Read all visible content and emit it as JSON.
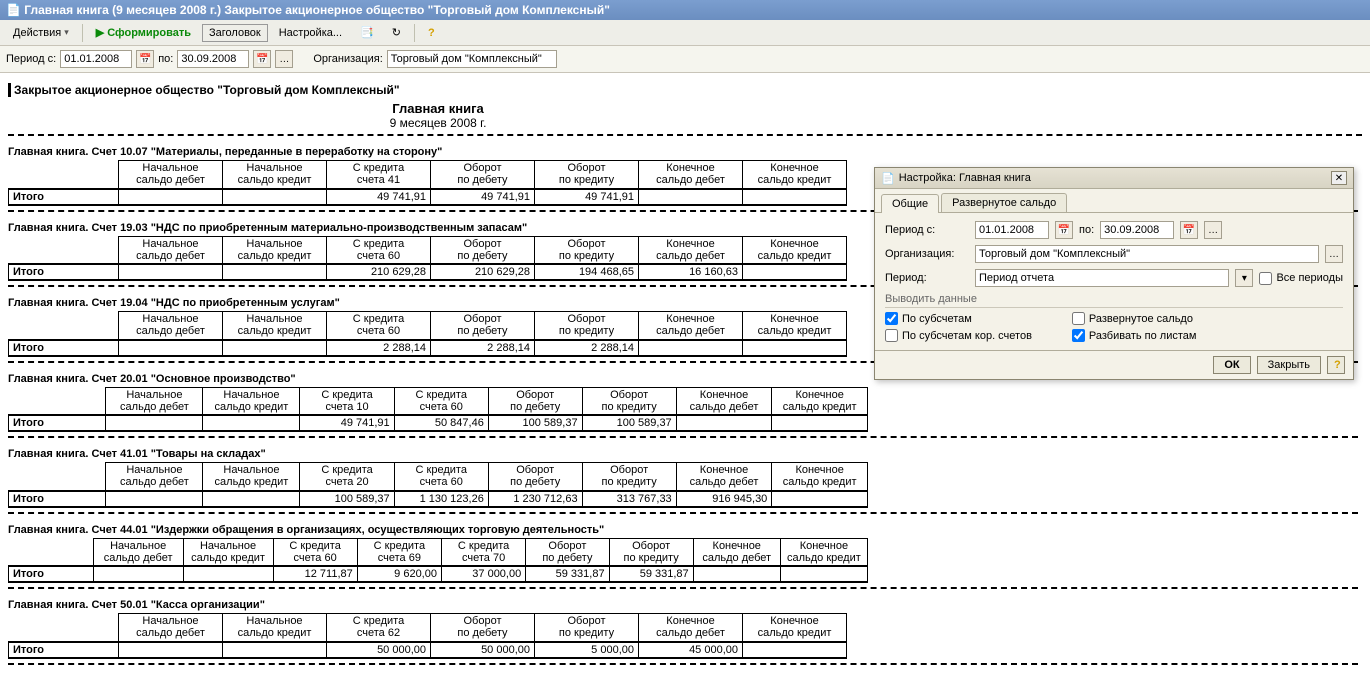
{
  "window": {
    "title": "Главная книга (9 месяцев 2008 г.) Закрытое акционерное общество \"Торговый дом Комплексный\""
  },
  "toolbar": {
    "actions": "Действия",
    "generate": "Сформировать",
    "header": "Заголовок",
    "settings": "Настройка..."
  },
  "filter": {
    "period_from": "Период с:",
    "date_from": "01.01.2008",
    "to": "по:",
    "date_to": "30.09.2008",
    "org_label": "Организация:",
    "org": "Торговый дом \"Комплексный\""
  },
  "report": {
    "org": "Закрытое акционерное общество \"Торговый дом Комплексный\"",
    "title": "Главная книга",
    "subtitle": "9 месяцев 2008 г.",
    "total_label": "Итого",
    "cols": {
      "beg_debit": "Начальное сальдо дебет",
      "beg_credit": "Начальное сальдо кредит",
      "turn_debit": "Оборот по дебету",
      "turn_credit": "Оборот по кредиту",
      "end_debit": "Конечное сальдо дебет",
      "end_credit": "Конечное сальдо кредит"
    },
    "sections": [
      {
        "title": "Главная книга. Счет 10.07 \"Материалы, переданные в переработку на сторону\"",
        "credits": [
          "С кредита счета 41"
        ],
        "row": [
          "",
          "",
          "49 741,91",
          "49 741,91",
          "49 741,91",
          "",
          ""
        ]
      },
      {
        "title": "Главная книга. Счет 19.03 \"НДС по приобретенным материально-производственным запасам\"",
        "credits": [
          "С кредита счета 60"
        ],
        "row": [
          "",
          "",
          "210 629,28",
          "210 629,28",
          "194 468,65",
          "16 160,63",
          ""
        ]
      },
      {
        "title": "Главная книга. Счет 19.04 \"НДС по приобретенным услугам\"",
        "credits": [
          "С кредита счета 60"
        ],
        "row": [
          "",
          "",
          "2 288,14",
          "2 288,14",
          "2 288,14",
          "",
          ""
        ]
      },
      {
        "title": "Главная книга. Счет 20.01 \"Основное производство\"",
        "credits": [
          "С кредита счета 10",
          "С кредита счета 60"
        ],
        "row": [
          "",
          "",
          "49 741,91",
          "50 847,46",
          "100 589,37",
          "100 589,37",
          "",
          ""
        ]
      },
      {
        "title": "Главная книга. Счет 41.01 \"Товары на складах\"",
        "credits": [
          "С кредита счета 20",
          "С кредита счета 60"
        ],
        "row": [
          "",
          "",
          "100 589,37",
          "1 130 123,26",
          "1 230 712,63",
          "313 767,33",
          "916 945,30",
          ""
        ]
      },
      {
        "title": "Главная книга. Счет 44.01 \"Издержки обращения в организациях, осуществляющих торговую деятельность\"",
        "credits": [
          "С кредита счета 60",
          "С кредита счета 69",
          "С кредита счета 70"
        ],
        "row": [
          "",
          "",
          "12 711,87",
          "9 620,00",
          "37 000,00",
          "59 331,87",
          "59 331,87",
          "",
          ""
        ]
      },
      {
        "title": "Главная книга. Счет 50.01 \"Касса организации\"",
        "credits": [
          "С кредита счета 62"
        ],
        "row": [
          "",
          "",
          "50 000,00",
          "50 000,00",
          "5 000,00",
          "45 000,00",
          ""
        ]
      }
    ]
  },
  "dialog": {
    "title": "Настройка: Главная книга",
    "tab1": "Общие",
    "tab2": "Развернутое сальдо",
    "period_from": "Период с:",
    "date_from": "01.01.2008",
    "to": "по:",
    "date_to": "30.09.2008",
    "org_label": "Организация:",
    "org": "Торговый дом \"Комплексный\"",
    "period_label": "Период:",
    "period_val": "Период отчета",
    "all_periods": "Все периоды",
    "sec": "Выводить данные",
    "chk_subacc": "По субсчетам",
    "chk_subacc_cor": "По субсчетам кор. счетов",
    "chk_expanded": "Развернутое сальдо",
    "chk_split": "Разбивать по листам",
    "ok": "ОК",
    "close": "Закрыть"
  }
}
